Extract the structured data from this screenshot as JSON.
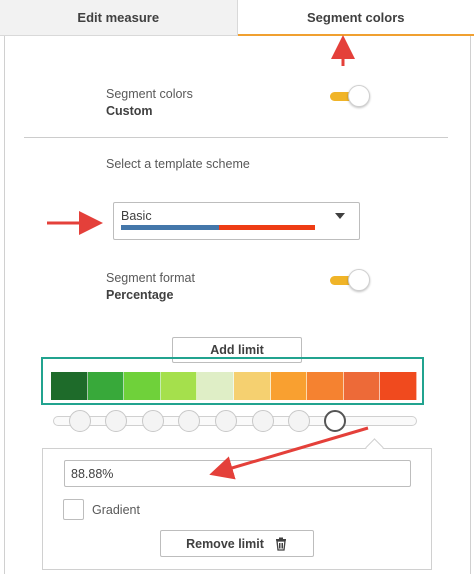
{
  "tabs": [
    {
      "label": "Edit measure"
    },
    {
      "label": "Segment colors"
    }
  ],
  "segment_colors": {
    "label": "Segment colors",
    "value": "Custom",
    "enabled": true
  },
  "template": {
    "label": "Select a template scheme",
    "selected": "Basic",
    "colors": [
      "#4477aa",
      "#ee3c14"
    ]
  },
  "segment_format": {
    "label": "Segment format",
    "value": "Percentage",
    "enabled": true
  },
  "add_limit_label": "Add limit",
  "segment_colors_list": [
    "#1e6b2a",
    "#38a93a",
    "#6fd13a",
    "#a5e04c",
    "#dfeec6",
    "#f5d070",
    "#f9a030",
    "#f58230",
    "#ed6a38",
    "#f04a1e"
  ],
  "limit_handles_count": 8,
  "selected_handle_index": 7,
  "limit_editor": {
    "value": "88.88%",
    "gradient_label": "Gradient",
    "gradient_checked": false,
    "remove_label": "Remove limit"
  },
  "annotation_color": "#e4403a"
}
